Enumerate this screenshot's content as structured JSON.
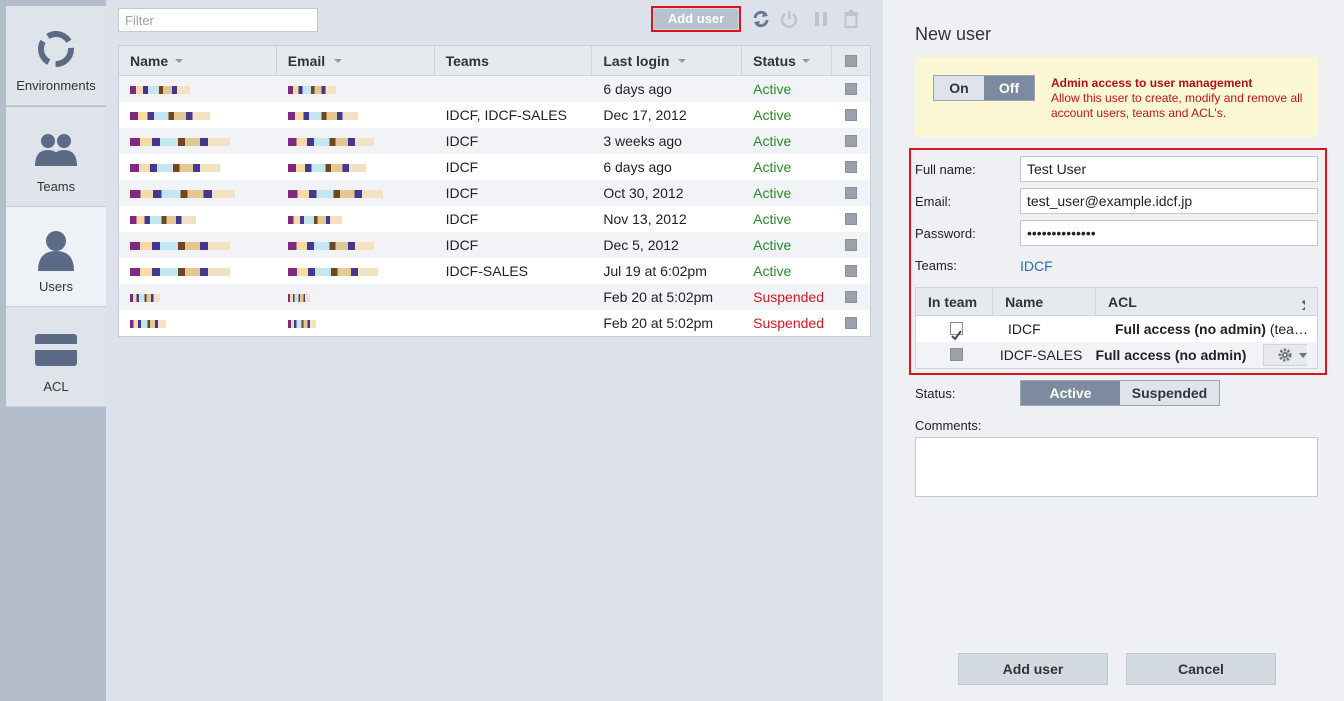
{
  "sidebar": {
    "items": [
      {
        "label": "Environments",
        "icon": "environments-icon",
        "active": false
      },
      {
        "label": "Teams",
        "icon": "teams-icon",
        "active": false
      },
      {
        "label": "Users",
        "icon": "users-icon",
        "active": true
      },
      {
        "label": "ACL",
        "icon": "acl-icon",
        "active": false
      }
    ]
  },
  "toolbar": {
    "filter_placeholder": "Filter",
    "add_user_label": "Add user",
    "icons": [
      "refresh-icon",
      "power-icon",
      "pause-icon",
      "trash-icon"
    ]
  },
  "users_table": {
    "columns": [
      "Name",
      "Email",
      "Teams",
      "Last login",
      "Status"
    ],
    "rows": [
      {
        "teams": "",
        "last_login": "6 days ago",
        "status": "Active"
      },
      {
        "teams": "IDCF, IDCF-SALES",
        "last_login": "Dec 17, 2012",
        "status": "Active"
      },
      {
        "teams": "IDCF",
        "last_login": "3 weeks ago",
        "status": "Active"
      },
      {
        "teams": "IDCF",
        "last_login": "6 days ago",
        "status": "Active"
      },
      {
        "teams": "IDCF",
        "last_login": "Oct 30, 2012",
        "status": "Active"
      },
      {
        "teams": "IDCF",
        "last_login": "Nov 13, 2012",
        "status": "Active"
      },
      {
        "teams": "IDCF",
        "last_login": "Dec 5, 2012",
        "status": "Active"
      },
      {
        "teams": "IDCF-SALES",
        "last_login": "Jul 19 at 6:02pm",
        "status": "Active"
      },
      {
        "teams": "",
        "last_login": "Feb 20 at 5:02pm",
        "status": "Suspended"
      },
      {
        "teams": "",
        "last_login": "Feb 20 at 5:02pm",
        "status": "Suspended"
      }
    ]
  },
  "form": {
    "title": "New user",
    "admin_toggle": {
      "on_label": "On",
      "off_label": "Off",
      "selected": "Off"
    },
    "admin_title": "Admin access to user management",
    "admin_desc": "Allow this user to create, modify and remove all account users, teams and ACL's.",
    "full_name_label": "Full name:",
    "full_name_value": "Test User",
    "email_label": "Email:",
    "email_value": "test_user@example.idcf.jp",
    "password_label": "Password:",
    "password_value": "••••••••••••••",
    "teams_label": "Teams:",
    "teams_value": "IDCF",
    "teams_table": {
      "columns": [
        "In team",
        "Name",
        "ACL"
      ],
      "rows": [
        {
          "in_team": true,
          "name": "IDCF",
          "acl": "Full access (no admin)",
          "acl_suffix": "(tea…"
        },
        {
          "in_team": false,
          "name": "IDCF-SALES",
          "acl": "Full access (no admin)",
          "acl_suffix": ""
        }
      ]
    },
    "status_label": "Status:",
    "status_active": "Active",
    "status_suspended": "Suspended",
    "status_selected": "Active",
    "comments_label": "Comments:",
    "submit_label": "Add user",
    "cancel_label": "Cancel"
  },
  "colors": {
    "accent": "#7d8ba0",
    "active": "#2b8a2b",
    "suspended": "#d9161f",
    "highlight": "#d9161f",
    "link": "#2a6db5"
  }
}
